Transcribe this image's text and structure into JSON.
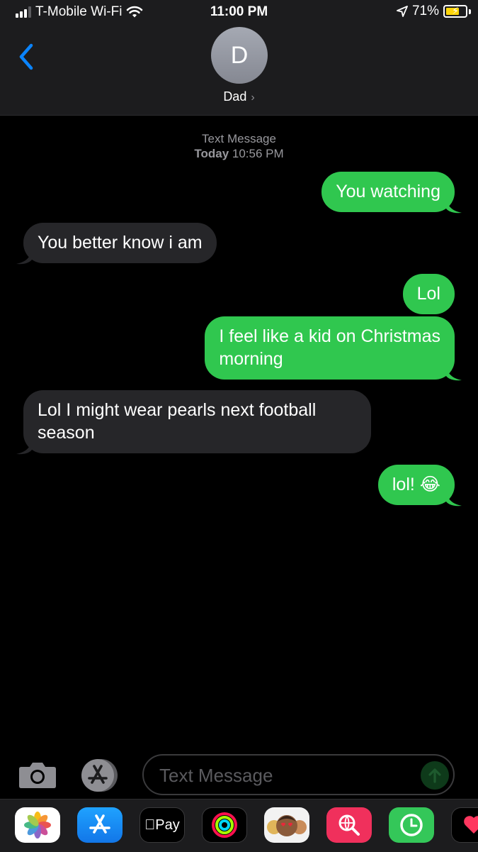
{
  "status_bar": {
    "carrier": "T-Mobile Wi-Fi",
    "time": "11:00 PM",
    "battery_percent": "71%",
    "battery_level": 0.71,
    "icons": [
      "signal-icon",
      "wifi-icon",
      "location-icon",
      "battery-charging-icon"
    ]
  },
  "header": {
    "avatar_initial": "D",
    "contact_name": "Dad",
    "back_icon": "chevron-left-icon",
    "contact_chevron": "›"
  },
  "conversation": {
    "service_label": "Text Message",
    "timestamp_day": "Today",
    "timestamp_time": "10:56 PM",
    "messages": [
      {
        "direction": "outgoing",
        "lines": [
          "You watching"
        ]
      },
      {
        "direction": "incoming",
        "lines": [
          "You better know i am"
        ]
      },
      {
        "direction": "outgoing",
        "lines": [
          "Lol"
        ]
      },
      {
        "direction": "outgoing",
        "lines": [
          "I feel like a kid on Christmas",
          "morning"
        ]
      },
      {
        "direction": "incoming",
        "lines": [
          "Lol I  might wear pearls next football",
          "season"
        ]
      },
      {
        "direction": "outgoing",
        "lines": [
          "lol! 😂"
        ]
      }
    ]
  },
  "compose": {
    "placeholder": "Text Message",
    "value": "",
    "icons": [
      "camera-icon",
      "app-store-icon",
      "send-arrow-icon"
    ]
  },
  "app_tray": {
    "apps": [
      {
        "name": "Photos",
        "icon": "photos-icon"
      },
      {
        "name": "App Store",
        "icon": "app-store-icon"
      },
      {
        "name": "Apple Pay",
        "icon": "apple-pay-icon",
        "label": "Pay"
      },
      {
        "name": "Activity",
        "icon": "activity-rings-icon"
      },
      {
        "name": "Memoji",
        "icon": "memoji-icon"
      },
      {
        "name": "Web Search",
        "icon": "web-search-icon"
      },
      {
        "name": "Clock",
        "icon": "clock-icon"
      },
      {
        "name": "Digital Touch",
        "icon": "digital-touch-icon"
      }
    ]
  },
  "colors": {
    "outgoing_bubble": "#30c74f",
    "incoming_bubble": "#262629",
    "accent_blue": "#0a84ff",
    "background": "#000000"
  }
}
